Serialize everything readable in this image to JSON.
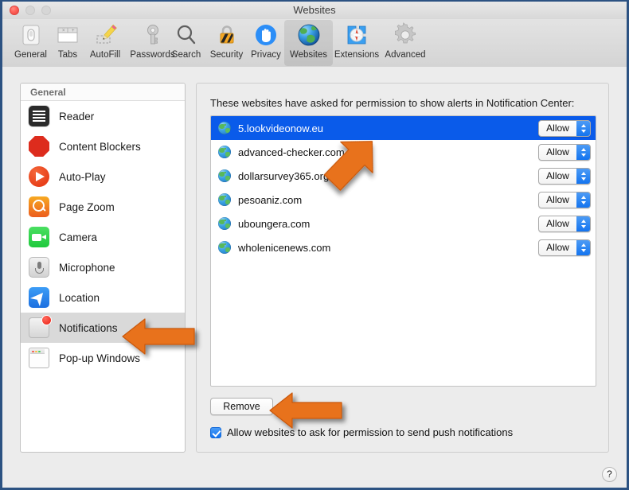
{
  "window": {
    "title": "Websites",
    "traffic_lights": [
      "close",
      "minimize",
      "zoom"
    ]
  },
  "toolbar": {
    "items": [
      {
        "label": "General",
        "icon": "general-icon",
        "selected": false
      },
      {
        "label": "Tabs",
        "icon": "tabs-icon",
        "selected": false
      },
      {
        "label": "AutoFill",
        "icon": "autofill-icon",
        "selected": false
      },
      {
        "label": "Passwords",
        "icon": "passwords-icon",
        "selected": false
      },
      {
        "label": "Search",
        "icon": "search-icon",
        "selected": false
      },
      {
        "label": "Security",
        "icon": "security-icon",
        "selected": false
      },
      {
        "label": "Privacy",
        "icon": "privacy-icon",
        "selected": false
      },
      {
        "label": "Websites",
        "icon": "websites-icon",
        "selected": true
      },
      {
        "label": "Extensions",
        "icon": "extensions-icon",
        "selected": false
      },
      {
        "label": "Advanced",
        "icon": "advanced-icon",
        "selected": false
      }
    ]
  },
  "sidebar": {
    "header": "General",
    "items": [
      {
        "label": "Reader",
        "icon": "reader-icon",
        "active": false
      },
      {
        "label": "Content Blockers",
        "icon": "content-blockers-icon",
        "active": false
      },
      {
        "label": "Auto-Play",
        "icon": "auto-play-icon",
        "active": false
      },
      {
        "label": "Page Zoom",
        "icon": "page-zoom-icon",
        "active": false
      },
      {
        "label": "Camera",
        "icon": "camera-icon",
        "active": false
      },
      {
        "label": "Microphone",
        "icon": "microphone-icon",
        "active": false
      },
      {
        "label": "Location",
        "icon": "location-icon",
        "active": false
      },
      {
        "label": "Notifications",
        "icon": "notifications-icon",
        "active": true
      },
      {
        "label": "Pop-up Windows",
        "icon": "popup-windows-icon",
        "active": false
      }
    ]
  },
  "main": {
    "description": "These websites have asked for permission to show alerts in Notification Center:",
    "sites": [
      {
        "name": "5.lookvideonow.eu",
        "permission": "Allow",
        "selected": true
      },
      {
        "name": "advanced-checker.com",
        "permission": "Allow",
        "selected": false
      },
      {
        "name": "dollarsurvey365.org",
        "permission": "Allow",
        "selected": false
      },
      {
        "name": "pesoaniz.com",
        "permission": "Allow",
        "selected": false
      },
      {
        "name": "uboungera.com",
        "permission": "Allow",
        "selected": false
      },
      {
        "name": "wholenicenews.com",
        "permission": "Allow",
        "selected": false
      }
    ],
    "remove_label": "Remove",
    "checkbox": {
      "label": "Allow websites to ask for permission to send push notifications",
      "checked": true
    },
    "help_label": "?"
  },
  "annotations": {
    "arrow_color": "#E8721B",
    "arrows": [
      {
        "name": "arrow-to-selected-site",
        "points_to": "5.lookvideonow.eu"
      },
      {
        "name": "arrow-to-notifications",
        "points_to": "Notifications"
      },
      {
        "name": "arrow-to-remove-button",
        "points_to": "Remove"
      }
    ]
  },
  "colors": {
    "window_border": "#2c5282",
    "selection_blue": "#0a5bea",
    "accent_orange": "#E8721B",
    "toolbar_bg": "#d9d9d9",
    "panel_bg": "#ececec"
  }
}
